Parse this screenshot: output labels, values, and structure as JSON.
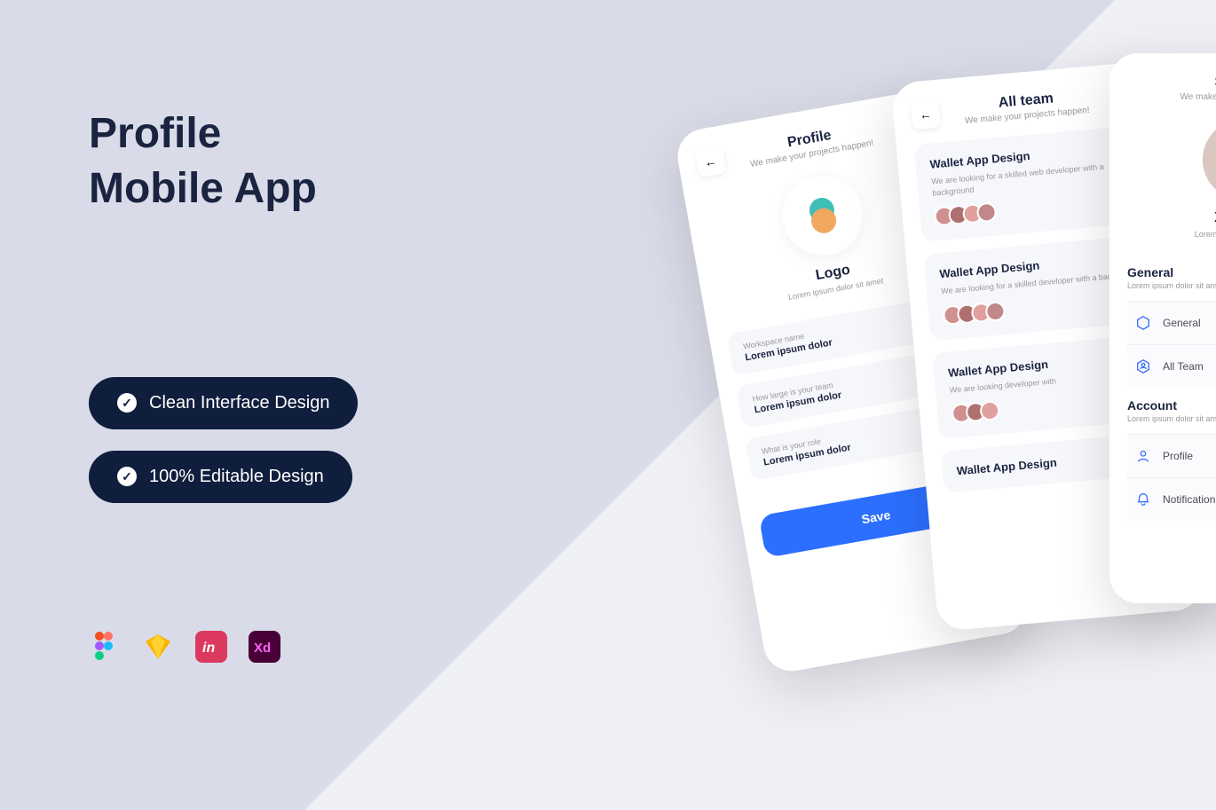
{
  "promo": {
    "title_line1": "Profile",
    "title_line2": "Mobile App",
    "pill1": "Clean Interface Design",
    "pill2": "100% Editable Design"
  },
  "screens": {
    "profile": {
      "title": "Profile",
      "subtitle": "We make your projects happen!",
      "logo_name": "Logo",
      "logo_desc": "Lorem ipsum dolor sit amet",
      "fields": [
        {
          "label": "Workspace name",
          "value": "Lorem ipsum dolor"
        },
        {
          "label": "How large is your team",
          "value": "Lorem ipsum dolor"
        },
        {
          "label": "What is your role",
          "value": "Lorem ipsum dolor"
        }
      ],
      "save": "Save"
    },
    "team": {
      "title": "All team",
      "subtitle": "We make your projects happen!",
      "cards": [
        {
          "title": "Wallet App Design",
          "desc": "We are looking for a skilled web developer with a background"
        },
        {
          "title": "Wallet App Design",
          "desc": "We are looking for a skilled developer with a back"
        },
        {
          "title": "Wallet App Design",
          "desc": "We are looking developer with"
        },
        {
          "title": "Wallet App Design",
          "desc": ""
        }
      ]
    },
    "settings": {
      "title": "Settings",
      "subtitle": "We make your projects happen!",
      "user_name": "Xinnthin",
      "user_sub": "Lorem ipsum dolor sit amet",
      "general_title": "General",
      "general_sub": "Lorem ipsum dolor sit amet",
      "account_title": "Account",
      "account_sub": "Lorem ipsum dolor sit amet",
      "items": {
        "general": "General",
        "allteam": "All Team",
        "profile": "Profile",
        "notification": "Notification"
      }
    }
  },
  "icons": {
    "figma": "figma",
    "sketch": "sketch",
    "invision": "invision",
    "xd": "xd"
  }
}
